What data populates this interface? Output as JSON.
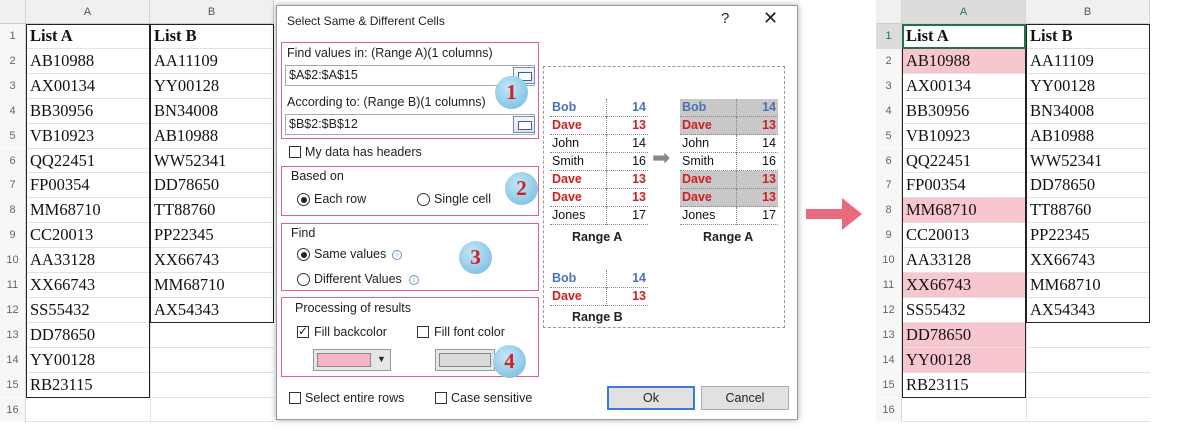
{
  "left_sheet": {
    "columns": [
      "A",
      "B"
    ],
    "row_numbers": [
      "1",
      "2",
      "3",
      "4",
      "5",
      "6",
      "7",
      "8",
      "9",
      "10",
      "11",
      "12",
      "13",
      "14",
      "15",
      "16"
    ],
    "col_a": [
      "List A",
      "AB10988",
      "AX00134",
      "BB30956",
      "VB10923",
      "QQ22451",
      "FP00354",
      "MM68710",
      "CC20013",
      "AA33128",
      "XX66743",
      "SS55432",
      "DD78650",
      "YY00128",
      "RB23115"
    ],
    "col_b": [
      "List B",
      "AA11109",
      "YY00128",
      "BN34008",
      "AB10988",
      "WW52341",
      "DD78650",
      "TT88760",
      "PP22345",
      "XX66743",
      "MM68710",
      "AX54343"
    ]
  },
  "dialog": {
    "title": "Select Same & Different Cells",
    "help": "?",
    "close": "✕",
    "find_values_label": "Find values in: (Range A)(1 columns)",
    "find_values_value": "$A$2:$A$15",
    "according_label": "According to: (Range B)(1 columns)",
    "according_value": "$B$2:$B$12",
    "headers_label": "My data has headers",
    "based_on_label": "Based on",
    "each_row": "Each row",
    "single_cell": "Single cell",
    "find_label": "Find",
    "same_values": "Same values",
    "different_values": "Different Values",
    "info": "i",
    "processing_label": "Processing of results",
    "fill_backcolor": "Fill backcolor",
    "fill_font_color": "Fill font color",
    "select_entire_rows": "Select entire rows",
    "case_sensitive": "Case sensitive",
    "ok": "Ok",
    "cancel": "Cancel",
    "badges": [
      "1",
      "2",
      "3",
      "4"
    ],
    "backcolor": "#f8b6c4",
    "fontcolor": "#d9d9d9",
    "dropdown_arrow": "▼",
    "arrow": "➡"
  },
  "preview": {
    "range_a": [
      {
        "name": "Bob",
        "value": "14",
        "style": "blue"
      },
      {
        "name": "Dave",
        "value": "13",
        "style": "red"
      },
      {
        "name": "John",
        "value": "14",
        "style": "plain"
      },
      {
        "name": "Smith",
        "value": "16",
        "style": "plain"
      },
      {
        "name": "Dave",
        "value": "13",
        "style": "red"
      },
      {
        "name": "Dave",
        "value": "13",
        "style": "red"
      },
      {
        "name": "Jones",
        "value": "17",
        "style": "plain"
      }
    ],
    "range_b": [
      {
        "name": "Bob",
        "value": "14",
        "style": "blue"
      },
      {
        "name": "Dave",
        "value": "13",
        "style": "red"
      }
    ],
    "caption_a": "Range A",
    "caption_a2": "Range A",
    "caption_b": "Range B"
  },
  "right_sheet": {
    "columns": [
      "A",
      "B"
    ],
    "row_numbers": [
      "1",
      "2",
      "3",
      "4",
      "5",
      "6",
      "7",
      "8",
      "9",
      "10",
      "11",
      "12",
      "13",
      "14",
      "15",
      "16"
    ],
    "col_a": [
      "List A",
      "AB10988",
      "AX00134",
      "BB30956",
      "VB10923",
      "QQ22451",
      "FP00354",
      "MM68710",
      "CC20013",
      "AA33128",
      "XX66743",
      "SS55432",
      "DD78650",
      "YY00128",
      "RB23115"
    ],
    "col_b": [
      "List B",
      "AA11109",
      "YY00128",
      "BN34008",
      "AB10988",
      "WW52341",
      "DD78650",
      "TT88760",
      "PP22345",
      "XX66743",
      "MM68710",
      "AX54343"
    ],
    "highlighted_rows": [
      1,
      7,
      10,
      12,
      13
    ],
    "highlight_color": "#f8c6cf"
  },
  "colors": {
    "header_text": "#e2167a",
    "red": "#d41f1f",
    "blue": "#4a74b4",
    "panel_border": "#e0637d",
    "arrow": "#e86a7f"
  }
}
